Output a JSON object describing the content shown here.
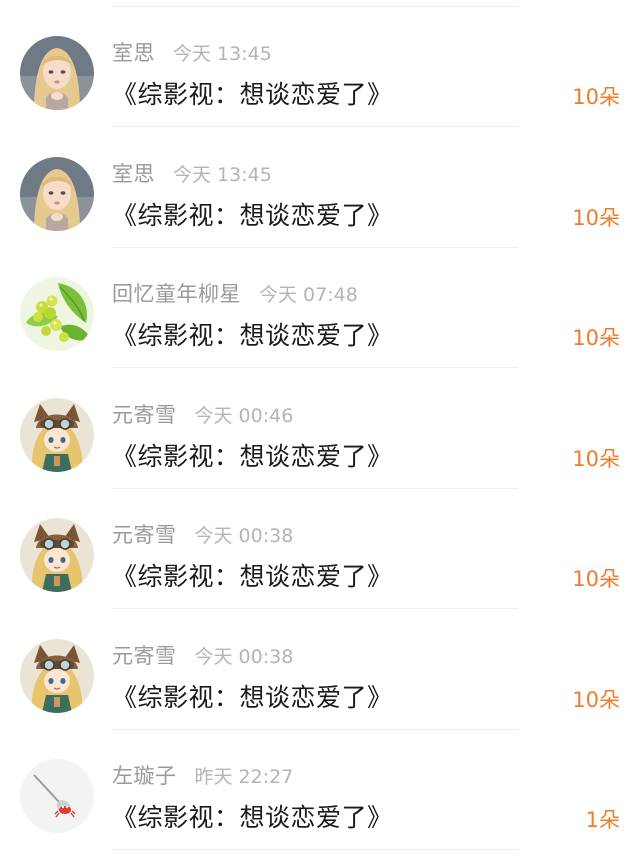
{
  "gifts": [
    {
      "name": "室思",
      "time": "今天 13:45",
      "title": "《综影视：想谈恋爱了》",
      "amount": "10朵",
      "avatar": "anime-girl-blonde-avatar"
    },
    {
      "name": "室思",
      "time": "今天 13:45",
      "title": "《综影视：想谈恋爱了》",
      "amount": "10朵",
      "avatar": "anime-girl-blonde-avatar"
    },
    {
      "name": "回忆童年柳星",
      "time": "今天 07:48",
      "title": "《综影视：想谈恋爱了》",
      "amount": "10朵",
      "avatar": "green-fruit-leaves-avatar"
    },
    {
      "name": "元寄雪",
      "time": "今天 00:46",
      "title": "《综影视：想谈恋爱了》",
      "amount": "10朵",
      "avatar": "aviator-cat-girl-avatar"
    },
    {
      "name": "元寄雪",
      "time": "今天 00:38",
      "title": "《综影视：想谈恋爱了》",
      "amount": "10朵",
      "avatar": "aviator-cat-girl-avatar"
    },
    {
      "name": "元寄雪",
      "time": "今天 00:38",
      "title": "《综影视：想谈恋爱了》",
      "amount": "10朵",
      "avatar": "aviator-cat-girl-avatar"
    },
    {
      "name": "左璇子",
      "time": "昨天 22:27",
      "title": "《综影视：想谈恋爱了》",
      "amount": "1朵",
      "avatar": "crab-spoon-avatar"
    }
  ],
  "colors": {
    "amount": "#f07c2b",
    "name": "#9a9a9a",
    "time": "#b4b4b4",
    "title": "#1a1a1a",
    "divider": "#eeeeee"
  }
}
